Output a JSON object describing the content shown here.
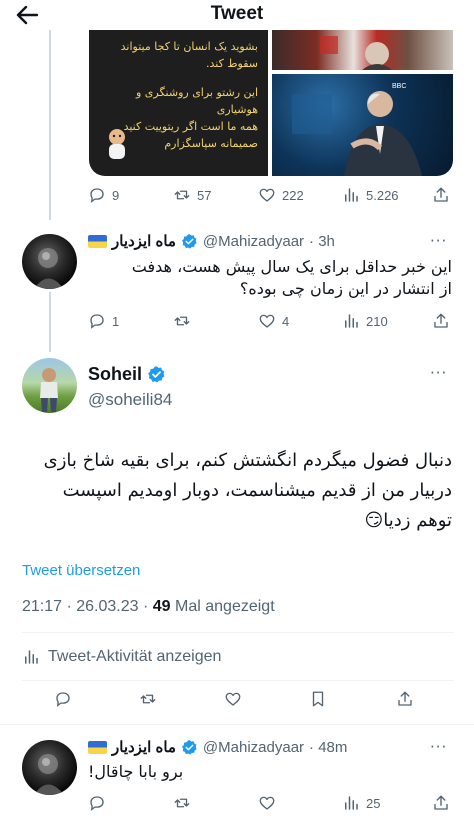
{
  "header": {
    "title": "Tweet",
    "back_icon": "arrow-left-icon"
  },
  "media": {
    "left_lines": [
      "بشوید یک انسان تا کجا میتواند",
      "سقوط کند.",
      "",
      "این رشتو برای روشنگری و هوشیاری",
      "همه ما است اگر ریتوییت کنید",
      "صمیمانه سپاسگزارم"
    ]
  },
  "prev_tweet_actions": {
    "replies": "9",
    "retweets": "57",
    "likes": "222",
    "views": "5.226"
  },
  "reply1": {
    "name": "ماه ایزدیار",
    "handle": "@Mahizadyaar",
    "time": "· 3h",
    "text_line1": "این خبر حداقل برای یک سال پیش هست، هدفت",
    "text_line2": "از انتشار در این زمان چی بوده؟",
    "replies": "1",
    "retweets": "",
    "likes": "4",
    "views": "210"
  },
  "main_tweet": {
    "name": "Soheil",
    "handle": "@soheili84",
    "text_line1": "دنبال فضول میگردم انگشتش کنم، برای بقیه شاخ بازی",
    "text_line2": "دربیار من از قدیم میشناسمت، دوبار اومدیم اسپست",
    "text_line3": "توهم زدیا😏",
    "translate": "Tweet übersetzen",
    "timestamp": "21:17 · 26.03.23 ·",
    "view_count": "49",
    "view_label": "Mal angezeigt",
    "activity": "Tweet-Aktivität anzeigen"
  },
  "reply2": {
    "name": "ماه ایزدیار",
    "handle": "@Mahizadyaar",
    "time": "· 48m",
    "text": "برو بابا چاقال!",
    "views": "25"
  },
  "colors": {
    "accent": "#1d9bf0",
    "secondary": "#536471",
    "divider": "#eff3f4"
  }
}
